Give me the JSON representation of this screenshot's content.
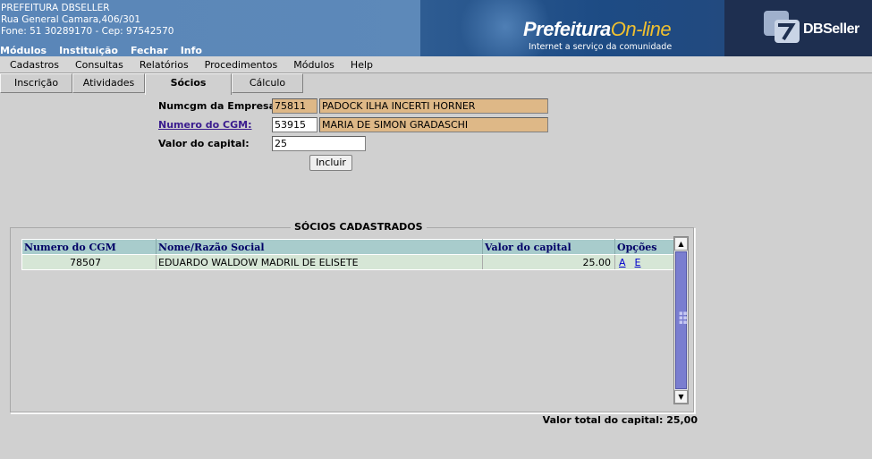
{
  "header": {
    "company": "PREFEITURA DBSELLER",
    "address": "Rua General Camara,406/301",
    "contact": "Fone: 51 30289170  -  Cep: 97542570",
    "top_menu": [
      "Módulos",
      "Instituição",
      "Fechar",
      "Info"
    ],
    "logo_text_a": "Prefeitura",
    "logo_text_b": "On-line",
    "logo_tagline": "Internet a serviço da comunidade",
    "brand": "DBSeller"
  },
  "menubar": [
    "Cadastros",
    "Consultas",
    "Relatórios",
    "Procedimentos",
    "Módulos",
    "Help"
  ],
  "tabs": [
    {
      "label": "Inscrição"
    },
    {
      "label": "Atividades"
    },
    {
      "label": "Sócios"
    },
    {
      "label": "Cálculo"
    }
  ],
  "active_tab": "Sócios",
  "form": {
    "numcgm_empresa_label": "Numcgm da Empresa:",
    "numcgm_empresa_value": "75811",
    "empresa_nome": "PADOCK ILHA INCERTI HORNER",
    "numero_cgm_label": "Numero do CGM:",
    "numero_cgm_value": "53915",
    "cgm_nome": "MARIA DE SIMON GRADASCHI",
    "valor_capital_label": "Valor do capital:",
    "valor_capital_value": "25",
    "incluir_label": "Incluir"
  },
  "socios": {
    "legend": "SÓCIOS CADASTRADOS",
    "columns": [
      "Numero do CGM",
      "Nome/Razão Social",
      "Valor do capital",
      "Opções"
    ],
    "rows": [
      {
        "cgm": "78507",
        "nome": "EDUARDO WALDOW MADRIL DE ELISETE",
        "valor": "25.00",
        "opt_a": "A",
        "opt_e": "E"
      }
    ],
    "total_label": "Valor total do capital: 25,00"
  },
  "colors": {
    "header_blue": "#5f86b4",
    "readonly_field": "#deb887",
    "grid_header": "#a8cccc",
    "grid_row": "#d6e6d6",
    "scroll_thumb": "#7a7ed0"
  }
}
